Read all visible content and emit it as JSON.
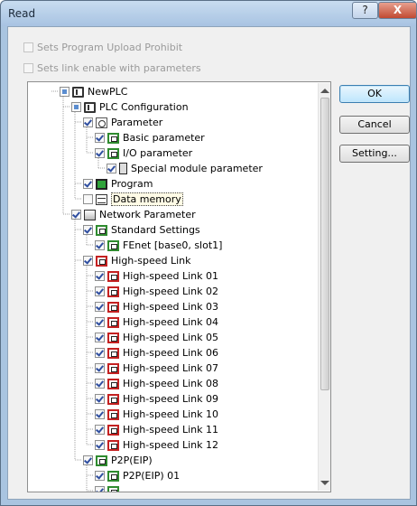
{
  "window": {
    "title": "Read",
    "help_label": "?",
    "close_label": "X"
  },
  "options": {
    "upload_prohibit": "Sets Program Upload Prohibit",
    "link_enable": "Sets link enable with parameters"
  },
  "buttons": {
    "ok": "OK",
    "cancel": "Cancel",
    "setting": "Setting..."
  },
  "tree": [
    {
      "label": "NewPLC",
      "level": 0,
      "state": "partial",
      "icon": "plc-icon"
    },
    {
      "label": "PLC Configuration",
      "level": 1,
      "state": "partial",
      "icon": "plc-icon"
    },
    {
      "label": "Parameter",
      "level": 2,
      "state": "checked",
      "icon": "parameter-icon"
    },
    {
      "label": "Basic parameter",
      "level": 3,
      "state": "checked",
      "icon": "basic-parameter-icon"
    },
    {
      "label": "I/O parameter",
      "level": 3,
      "state": "checked",
      "icon": "io-parameter-icon"
    },
    {
      "label": "Special module parameter",
      "level": 4,
      "state": "checked",
      "icon": "module-icon"
    },
    {
      "label": "Program",
      "level": 2,
      "state": "checked",
      "icon": "program-icon"
    },
    {
      "label": "Data memory",
      "level": 2,
      "state": "unchecked",
      "icon": "memory-icon",
      "selected": true
    },
    {
      "label": "Network Parameter",
      "level": 1,
      "state": "checked",
      "icon": "network-icon"
    },
    {
      "label": "Standard Settings",
      "level": 2,
      "state": "checked",
      "icon": "standard-settings-icon"
    },
    {
      "label": "FEnet [base0, slot1]",
      "level": 3,
      "state": "checked",
      "icon": "fenet-icon"
    },
    {
      "label": "High-speed Link",
      "level": 2,
      "state": "checked",
      "icon": "link-icon"
    },
    {
      "label": "High-speed Link 01",
      "level": 3,
      "state": "checked",
      "icon": "link-icon"
    },
    {
      "label": "High-speed Link 02",
      "level": 3,
      "state": "checked",
      "icon": "link-icon"
    },
    {
      "label": "High-speed Link 03",
      "level": 3,
      "state": "checked",
      "icon": "link-icon"
    },
    {
      "label": "High-speed Link 04",
      "level": 3,
      "state": "checked",
      "icon": "link-icon"
    },
    {
      "label": "High-speed Link 05",
      "level": 3,
      "state": "checked",
      "icon": "link-icon"
    },
    {
      "label": "High-speed Link 06",
      "level": 3,
      "state": "checked",
      "icon": "link-icon"
    },
    {
      "label": "High-speed Link 07",
      "level": 3,
      "state": "checked",
      "icon": "link-icon"
    },
    {
      "label": "High-speed Link 08",
      "level": 3,
      "state": "checked",
      "icon": "link-icon"
    },
    {
      "label": "High-speed Link 09",
      "level": 3,
      "state": "checked",
      "icon": "link-icon"
    },
    {
      "label": "High-speed Link 10",
      "level": 3,
      "state": "checked",
      "icon": "link-icon"
    },
    {
      "label": "High-speed Link 11",
      "level": 3,
      "state": "checked",
      "icon": "link-icon"
    },
    {
      "label": "High-speed Link 12",
      "level": 3,
      "state": "checked",
      "icon": "link-icon"
    },
    {
      "label": "P2P(EIP)",
      "level": 2,
      "state": "checked",
      "icon": "p2p-icon"
    },
    {
      "label": "P2P(EIP) 01",
      "level": 3,
      "state": "checked",
      "icon": "p2p-icon"
    },
    {
      "label": "",
      "level": 3,
      "state": "checked",
      "icon": "p2p-icon"
    }
  ]
}
